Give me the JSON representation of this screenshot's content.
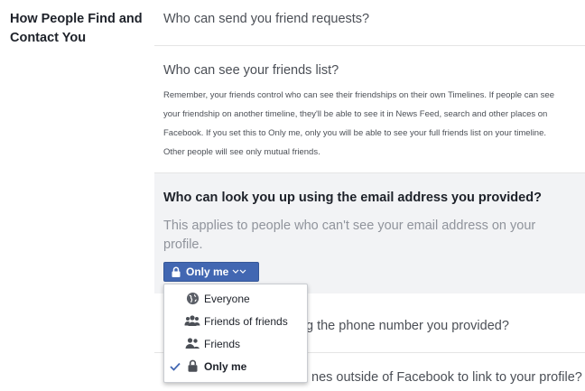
{
  "section": {
    "title": "How People Find and Contact You"
  },
  "rows": [
    {
      "question": "Who can send you friend requests?"
    },
    {
      "question": "Who can see your friends list?",
      "description": "Remember, your friends control who can see their friendships on their own Timelines. If people can see your friendship on another timeline, they'll be able to see it in News Feed, search and other places on Facebook. If you set this to Only me, only you will be able to see your full friends list on your timeline. Other people will see only mutual friends."
    },
    {
      "question": "Who can look you up using the email address you provided?",
      "description": "This applies to people who can't see your email address on your profile.",
      "selected_value": "Only me"
    },
    {
      "question_visible": "g the phone number you provided?"
    },
    {
      "question_visible": "nes outside of Facebook to link to your profile?"
    }
  ],
  "dropdown": {
    "options": [
      {
        "label": "Everyone",
        "icon": "globe-icon"
      },
      {
        "label": "Friends of friends",
        "icon": "friends-of-friends-icon"
      },
      {
        "label": "Friends",
        "icon": "friends-icon"
      },
      {
        "label": "Only me",
        "icon": "lock-icon",
        "selected": true
      }
    ]
  },
  "colors": {
    "button_bg": "#4267b2",
    "highlight_row": "#f2f3f5",
    "muted_text": "#90949c"
  }
}
